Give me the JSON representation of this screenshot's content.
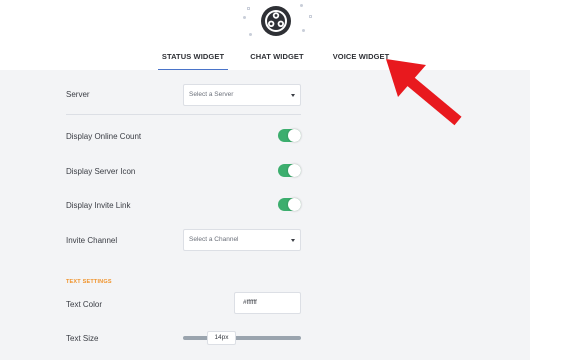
{
  "tabs": [
    {
      "label": "STATUS WIDGET",
      "active": true
    },
    {
      "label": "CHAT WIDGET",
      "active": false
    },
    {
      "label": "VOICE WIDGET",
      "active": false
    }
  ],
  "settings": {
    "server": {
      "label": "Server",
      "select_value": "Select a Server"
    },
    "online_count": {
      "label": "Display Online Count",
      "enabled": true
    },
    "server_icon": {
      "label": "Display Server Icon",
      "enabled": true
    },
    "invite_link": {
      "label": "Display Invite Link",
      "enabled": true
    },
    "invite_channel": {
      "label": "Invite Channel",
      "select_value": "Select a Channel"
    }
  },
  "text_settings": {
    "title": "TEXT SETTINGS",
    "text_color": {
      "label": "Text Color",
      "value": "#ffffff"
    },
    "text_size": {
      "label": "Text Size",
      "value": "14px"
    }
  },
  "colors": {
    "accent_tab": "#4a74c9",
    "toggle_on": "#3cae6e",
    "section_title": "#f0932b",
    "arrow": "#e8191e"
  },
  "icons": [
    "app-logo-icon",
    "caret-down-icon",
    "red-arrow-annotation"
  ]
}
